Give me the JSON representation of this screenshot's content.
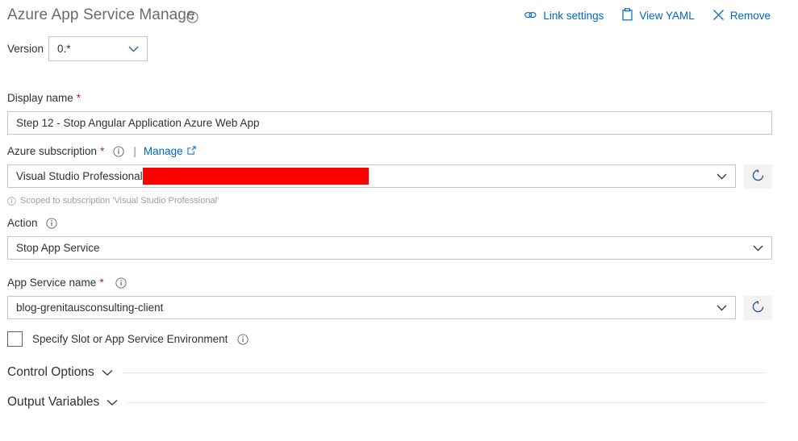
{
  "header": {
    "title": "Azure App Service Manage",
    "title_info_icon": "info-icon",
    "actions": [
      {
        "label": "Link settings",
        "icon": "link-chain-icon"
      },
      {
        "label": "View YAML",
        "icon": "clipboard-icon"
      },
      {
        "label": "Remove",
        "icon": "close-x-icon"
      }
    ]
  },
  "version": {
    "label": "Version",
    "value": "0.*",
    "chevron_icon": "chevron-down-icon"
  },
  "fields": {
    "display_name": {
      "label": "Display name",
      "required": "*",
      "value": "Step 12 - Stop Angular Application Azure Web App"
    },
    "azure_subscription": {
      "label": "Azure subscription",
      "required": "*",
      "info_icon": "info-icon",
      "separator": "|",
      "manage_label": "Manage",
      "manage_icon": "external-link-icon",
      "value": "Visual Studio Professional",
      "redacted": true,
      "chevron_icon": "chevron-down-icon",
      "refresh_icon": "refresh-icon",
      "hint": "Scoped to subscription 'Visual Studio Professional'",
      "hint_icon": "info-icon"
    },
    "action": {
      "label": "Action",
      "info_icon": "info-icon",
      "value": "Stop App Service",
      "chevron_icon": "chevron-down-icon"
    },
    "app_service_name": {
      "label": "App Service name",
      "required": "*",
      "info_icon": "info-icon",
      "value": "blog-grenitausconsulting-client",
      "chevron_icon": "chevron-down-icon",
      "refresh_icon": "refresh-icon"
    },
    "specify_slot": {
      "label": "Specify Slot or App Service Environment",
      "checked": false,
      "info_icon": "info-icon"
    }
  },
  "sections": [
    {
      "title": "Control Options",
      "chevron_icon": "chevron-down-icon",
      "expanded": false
    },
    {
      "title": "Output Variables",
      "chevron_icon": "chevron-down-icon",
      "expanded": false
    }
  ],
  "colors": {
    "link_blue": "#0066cc",
    "required_red": "#a4262c",
    "redaction_red": "#ff0000",
    "text_primary": "#323130",
    "title_gray": "#6b6b6b",
    "border_gray": "#c8c6c4",
    "button_bg": "#f3f2f1",
    "hint_gray": "#a19f9d"
  }
}
